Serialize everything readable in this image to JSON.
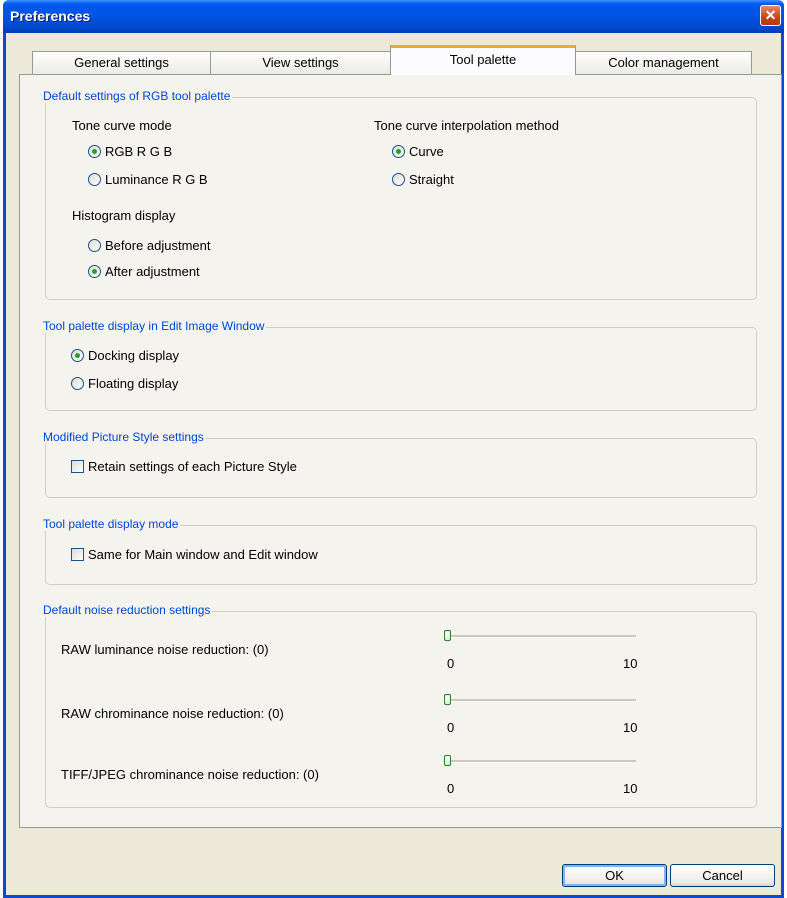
{
  "window": {
    "title": "Preferences"
  },
  "tabs": [
    {
      "label": "General settings"
    },
    {
      "label": "View settings"
    },
    {
      "label": "Tool palette"
    },
    {
      "label": "Color management"
    }
  ],
  "active_tab": "Tool palette",
  "rgb_group": {
    "legend": "Default settings of RGB tool palette",
    "tone_curve_mode": {
      "label": "Tone curve mode",
      "options": [
        "RGB R G B",
        "Luminance R G B"
      ],
      "selected": "RGB R G B"
    },
    "interpolation": {
      "label": "Tone curve interpolation method",
      "options": [
        "Curve",
        "Straight"
      ],
      "selected": "Curve"
    },
    "histogram": {
      "label": "Histogram display",
      "options": [
        "Before adjustment",
        "After adjustment"
      ],
      "selected": "After adjustment"
    }
  },
  "edit_window_group": {
    "legend": "Tool palette display in Edit Image Window",
    "options": [
      "Docking display",
      "Floating display"
    ],
    "selected": "Docking display"
  },
  "picture_style_group": {
    "legend": "Modified Picture Style settings",
    "checkbox": {
      "label": "Retain settings of each Picture Style",
      "checked": false
    }
  },
  "display_mode_group": {
    "legend": "Tool palette display mode",
    "checkbox": {
      "label": "Same for Main window and Edit window",
      "checked": false
    }
  },
  "noise_group": {
    "legend": "Default noise reduction settings",
    "sliders": [
      {
        "label": "RAW luminance noise reduction: (0)",
        "min": "0",
        "max": "10",
        "value": 0
      },
      {
        "label": "RAW chrominance noise reduction: (0)",
        "min": "0",
        "max": "10",
        "value": 0
      },
      {
        "label": "TIFF/JPEG chrominance noise reduction: (0)",
        "min": "0",
        "max": "10",
        "value": 0
      }
    ]
  },
  "buttons": {
    "ok": "OK",
    "cancel": "Cancel"
  },
  "colors": {
    "title_bar": "#0054e3",
    "legend": "#0046d5",
    "active_tab_accent": "#f5a733",
    "dialog_bg": "#ece9d8"
  },
  "icons": {
    "close": "close-icon",
    "radio": "radio-icon",
    "checkbox": "checkbox-icon"
  }
}
